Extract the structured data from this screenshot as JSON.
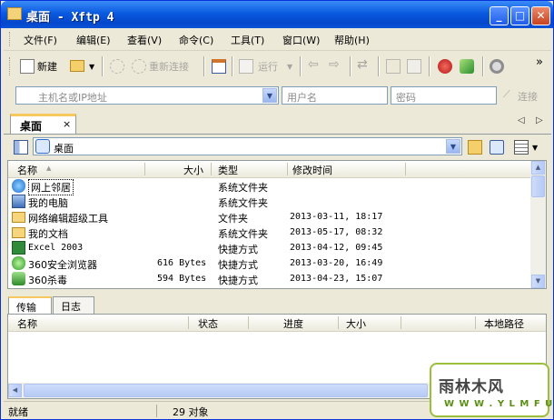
{
  "window": {
    "title": "桌面 - Xftp 4",
    "controls": {
      "minimize": "_",
      "maximize": "□",
      "close": "✕"
    }
  },
  "menubar": {
    "items": [
      "文件(F)",
      "编辑(E)",
      "查看(V)",
      "命令(C)",
      "工具(T)",
      "窗口(W)",
      "帮助(H)"
    ]
  },
  "toolbar": {
    "new_label": "新建",
    "reconnect_label": "重新连接",
    "run_label": "运行",
    "overflow": "»",
    "icons": [
      "new-session-icon",
      "open-folder-icon",
      "disconnect-icon",
      "reconnect-icon",
      "properties-icon",
      "run-icon",
      "back-icon",
      "forward-icon",
      "sync-icon",
      "copy-icon",
      "paste-icon",
      "xshell-icon",
      "xmanager-icon",
      "options-icon"
    ]
  },
  "connection": {
    "host_placeholder": "主机名或IP地址",
    "user_placeholder": "用户名",
    "password_placeholder": "密码",
    "connect_label": "连接"
  },
  "tabs": {
    "active": "桌面",
    "close": "×",
    "prev": "◁",
    "next": "▷"
  },
  "path": {
    "value": "桌面"
  },
  "filelist": {
    "columns": {
      "name": "名称",
      "size": "大小",
      "type": "类型",
      "modified": "修改时间"
    },
    "rows": [
      {
        "name": "网上邻居",
        "size": "",
        "type": "系统文件夹",
        "modified": "",
        "icon": "network-icon"
      },
      {
        "name": "我的电脑",
        "size": "",
        "type": "系统文件夹",
        "modified": "",
        "icon": "computer-icon"
      },
      {
        "name": "网络编辑超级工具",
        "size": "",
        "type": "文件夹",
        "modified": "2013-03-11, 18:17",
        "icon": "folder-icon"
      },
      {
        "name": "我的文档",
        "size": "",
        "type": "系统文件夹",
        "modified": "2013-05-17, 08:32",
        "icon": "documents-icon"
      },
      {
        "name": "Excel 2003",
        "size": "",
        "type": "快捷方式",
        "modified": "2013-04-12, 09:45",
        "icon": "excel-icon"
      },
      {
        "name": "360安全浏览器",
        "size": "616 Bytes",
        "type": "快捷方式",
        "modified": "2013-03-20, 16:49",
        "icon": "browser-360-icon"
      },
      {
        "name": "360杀毒",
        "size": "594 Bytes",
        "type": "快捷方式",
        "modified": "2013-04-23, 15:07",
        "icon": "antivirus-360-icon"
      }
    ]
  },
  "transfer": {
    "tabs": [
      "传输",
      "日志"
    ],
    "columns": [
      "名称",
      "状态",
      "进度",
      "大小",
      "本地路径"
    ]
  },
  "statusbar": {
    "state": "就绪",
    "count": "29 对象"
  },
  "watermark": {
    "line1": "雨林木风",
    "line2": "W W W . Y L M F U . C O M"
  }
}
